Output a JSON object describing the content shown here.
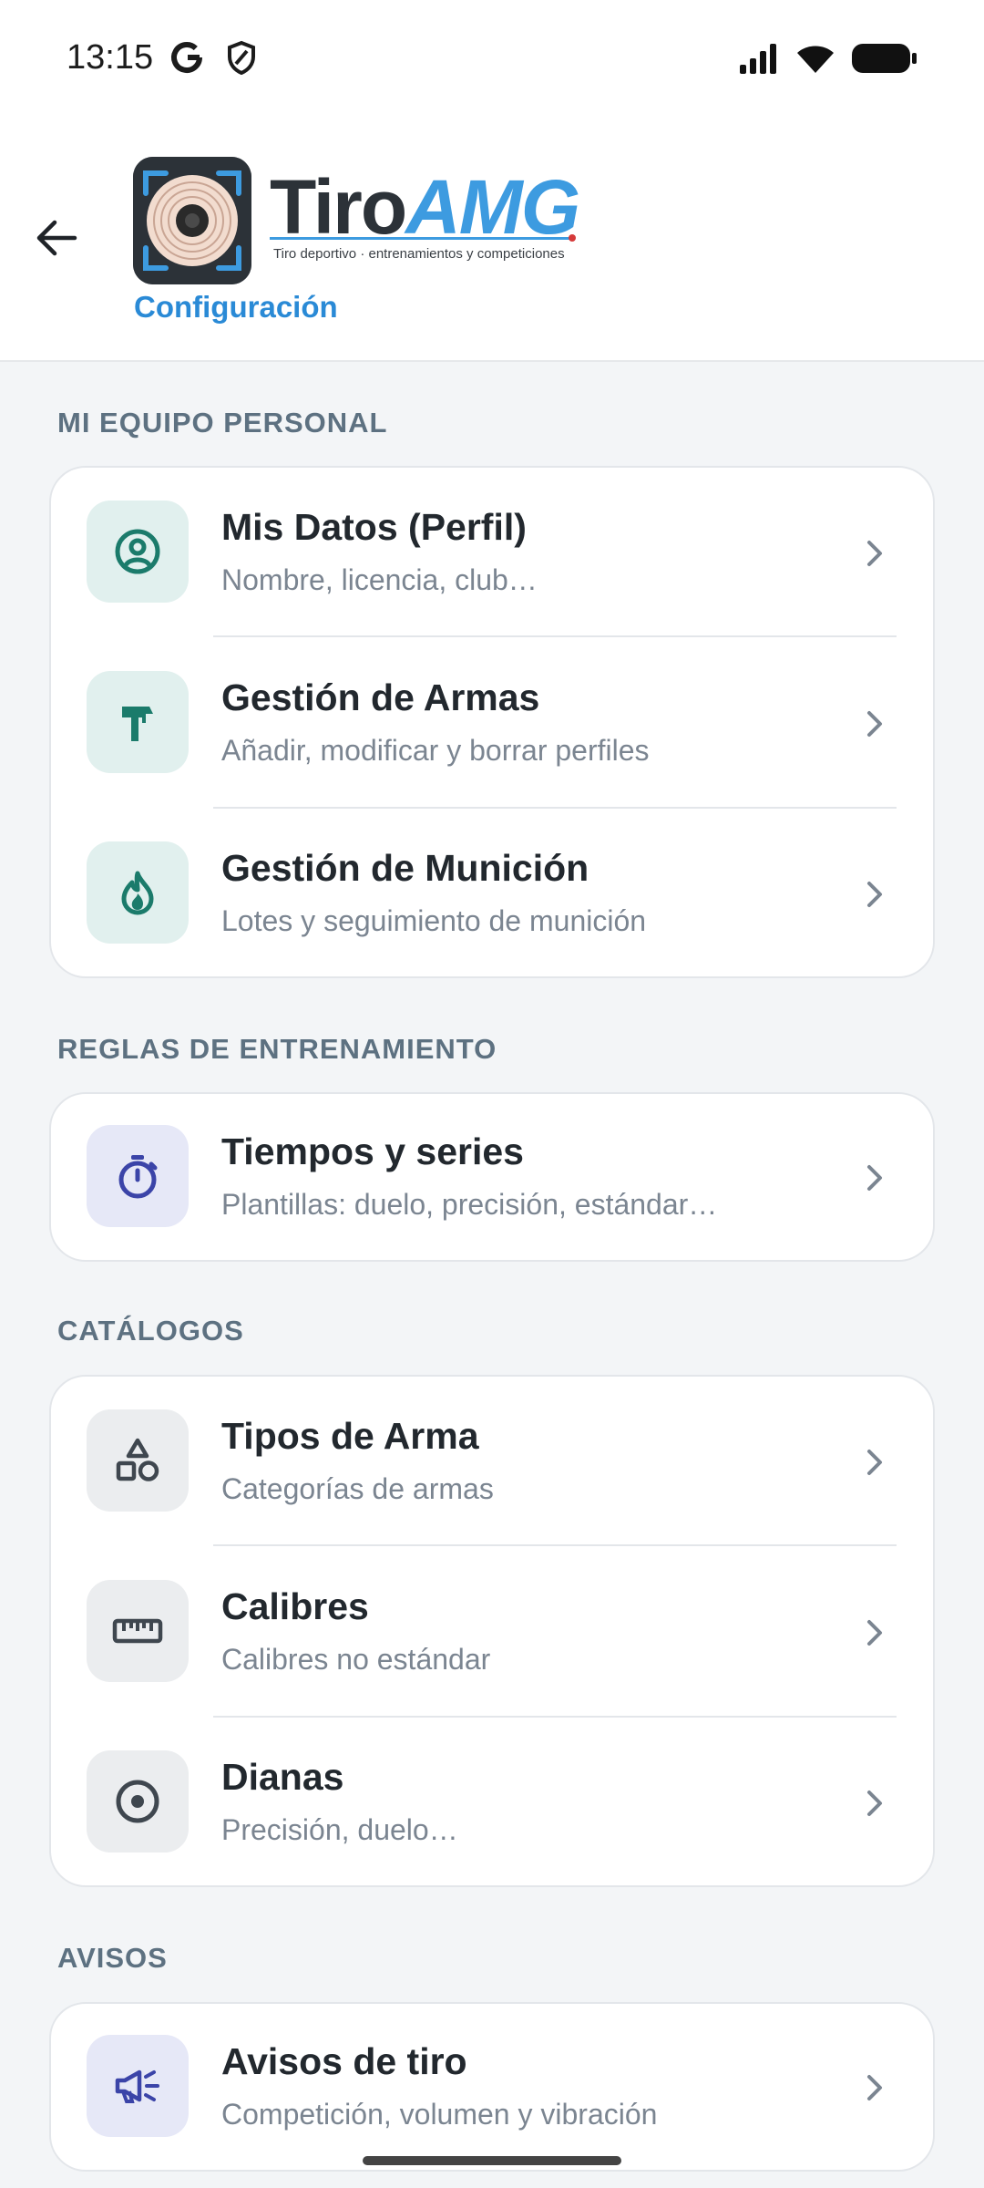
{
  "status": {
    "time": "13:15"
  },
  "header": {
    "brand_tiro": "Tiro",
    "brand_amg": "AMG",
    "tagline": "Tiro deportivo · entrenamientos y competiciones",
    "subtitle": "Configuración"
  },
  "sections": [
    {
      "title": "MI EQUIPO PERSONAL",
      "items": [
        {
          "title": "Mis Datos (Perfil)",
          "desc": "Nombre, licencia, club…",
          "icon": "user-circle-icon"
        },
        {
          "title": "Gestión de Armas",
          "desc": "Añadir, modificar y borrar perfiles",
          "icon": "hammer-icon"
        },
        {
          "title": "Gestión de Munición",
          "desc": "Lotes y seguimiento de munición",
          "icon": "flame-icon"
        }
      ]
    },
    {
      "title": "REGLAS DE ENTRENAMIENTO",
      "items": [
        {
          "title": "Tiempos y series",
          "desc": "Plantillas: duelo, precisión, estándar…",
          "icon": "timer-icon"
        }
      ]
    },
    {
      "title": "CATÁLOGOS",
      "items": [
        {
          "title": "Tipos de Arma",
          "desc": "Categorías de armas",
          "icon": "shapes-icon"
        },
        {
          "title": "Calibres",
          "desc": "Calibres no estándar",
          "icon": "ruler-icon"
        },
        {
          "title": "Dianas",
          "desc": "Precisión, duelo…",
          "icon": "target-icon"
        }
      ]
    },
    {
      "title": "AVISOS",
      "items": [
        {
          "title": "Avisos de tiro",
          "desc": "Competición, volumen y vibración",
          "icon": "megaphone-icon"
        }
      ]
    }
  ],
  "colors": {
    "accent": "#2a8ad6",
    "teal_icon": "#1b7b6b",
    "violet_icon": "#3b44a8",
    "grey_icon": "#3f474f"
  }
}
